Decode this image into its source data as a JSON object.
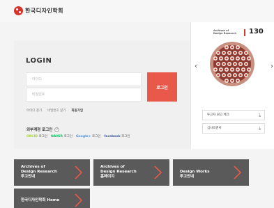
{
  "header": {
    "logo_text": "한국디자인학회"
  },
  "login": {
    "title": "LOGIN",
    "id_placeholder": "아이디",
    "pw_placeholder": "비밀번호",
    "submit_label": "로그인",
    "links": [
      "아이디 찾기",
      "비밀번호 찾기",
      "회원가입"
    ],
    "social_title": "외부계정 로그인",
    "social": [
      {
        "brand": "ORCID",
        "suffix": "로그인"
      },
      {
        "brand": "NAVER",
        "suffix": "로그인"
      },
      {
        "brand": "Google+",
        "suffix": "로그인"
      },
      {
        "brand": "facebook",
        "suffix": "로그인"
      }
    ]
  },
  "journal": {
    "cover_title_line1": "Archives of",
    "cover_title_line2": "Design Research",
    "issue_number": "130",
    "prev_arrow": "‹",
    "next_arrow": "›",
    "docs": [
      {
        "label": "투고자 원고 체크",
        "icon": "download-icon"
      },
      {
        "label": "심사의견서",
        "icon": "download-icon"
      }
    ]
  },
  "tiles": [
    {
      "line1": "Archives of",
      "line2": "Design Research",
      "line3": "투고안내"
    },
    {
      "line1": "Archives of",
      "line2": "Design Research",
      "line3": "홈페이지"
    },
    {
      "line1": "Design Works",
      "line2": "투고안내",
      "line3": ""
    },
    {
      "line1": "한국디자인학회 Home",
      "line2": "",
      "line3": ""
    }
  ],
  "colors": {
    "accent": "#e8594c",
    "tile_bg": "#5a5a5a",
    "brand_red": "#d5362c"
  }
}
